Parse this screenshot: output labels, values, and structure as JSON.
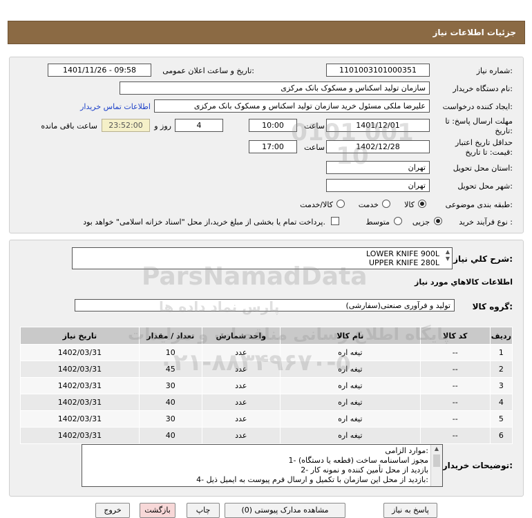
{
  "header": {
    "title": "جزئیات اطلاعات نیاز"
  },
  "form": {
    "need_number_label": "شماره نیاز:",
    "need_number": "1101003101000351",
    "announce_label": "تاریخ و ساعت اعلان عمومی:",
    "announce_value": "1401/11/26 - 09:58",
    "buyer_org_label": "نام دستگاه خریدار:",
    "buyer_org": "سازمان تولید اسکناس و مسکوک بانک مرکزی",
    "creator_label": "ایجاد کننده درخواست:",
    "creator": "علیرضا ملکی مسئول خرید سازمان تولید اسکناس و مسکوک بانک مرکزی",
    "contact_link": "اطلاعات تماس خریدار",
    "deadline_label_1": "مهلت ارسال پاسخ: تا",
    "deadline_label_2": "تاریخ:",
    "deadline_date": "1401/12/01",
    "hour_label": "ساعت",
    "deadline_time": "10:00",
    "days_value": "4",
    "days_label": "روز و",
    "remaining_time": "23:52:00",
    "remaining_label": "ساعت باقی مانده",
    "validity_label_1": "حداقل تاریخ اعتبار",
    "validity_label_2": "قیمت: تا تاریخ:",
    "validity_date": "1402/12/28",
    "validity_hour_label": "ساعت",
    "validity_time": "17:00",
    "province_label": "استان محل تحویل:",
    "province": "تهران",
    "city_label": "شهر محل تحویل:",
    "city": "تهران",
    "category_label": "طبقه بندی موضوعی:",
    "category_options": [
      "کالا",
      "خدمت",
      "کالا/خدمت"
    ],
    "category_selected": "کالا",
    "process_label": "نوع فرآیند خرید :",
    "process_options": [
      "جزیی",
      "متوسط"
    ],
    "process_selected": "جزیی",
    "payment_note": "پرداخت تمام یا بخشی از مبلغ خرید،از محل \"اسناد خزانه اسلامی\" خواهد بود."
  },
  "summary": {
    "label": "شرح کلي نياز:",
    "lines": [
      "LOWER KNIFE 900L",
      "UPPER KNIFE 280L"
    ]
  },
  "goods": {
    "section_title": "اطلاعات کالاهاي مورد نياز",
    "group_label": "گروه کالا:",
    "group_value": "تولید و فرآوری صنعتی(سفارشی)"
  },
  "table": {
    "headers": [
      "ردیف",
      "کد کالا",
      "نام کالا",
      "واحد شمارش",
      "تعداد / مقدار",
      "تاریخ نیاز"
    ],
    "rows": [
      [
        "1",
        "--",
        "تیغه اره",
        "عدد",
        "10",
        "1402/03/31"
      ],
      [
        "2",
        "--",
        "تیغه اره",
        "عدد",
        "45",
        "1402/03/31"
      ],
      [
        "3",
        "--",
        "تیغه اره",
        "عدد",
        "30",
        "1402/03/31"
      ],
      [
        "4",
        "--",
        "تیغه اره",
        "عدد",
        "40",
        "1402/03/31"
      ],
      [
        "5",
        "--",
        "تیغه اره",
        "عدد",
        "30",
        "1402/03/31"
      ],
      [
        "6",
        "--",
        "تیغه اره",
        "عدد",
        "40",
        "1402/03/31"
      ]
    ]
  },
  "notes": {
    "label": "توضیحات خریدار:",
    "lines": [
      "موارد الزامی:",
      "1- مجوز اساسنامه ساخت (قطعه یا دستگاه)",
      "2- بازدید از محل تأمین کننده و نمونه کار",
      "4- بازدید از محل این سازمان با تکمیل و ارسال فرم پیوست به ایمیل ذیل:"
    ]
  },
  "buttons": {
    "reply": "پاسخ به نیاز",
    "docs": "مشاهده مدارک پیوستی (0)",
    "print": "چاپ",
    "back": "بازگشت",
    "exit": "خروج"
  },
  "watermark": {
    "brand": "ParsNamadData",
    "brand_fa": "پارس نماد داده ها",
    "portal": "پایگاه اطلاع رسانی مناقصات و مزایدات",
    "phone": "۰۲۱-۸۸۳۴۹۶۷۰-۵",
    "digits": "0101 001 10"
  }
}
